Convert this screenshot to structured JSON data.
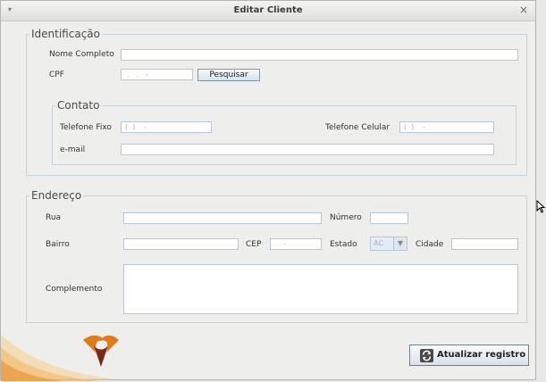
{
  "window": {
    "title": "Editar Cliente",
    "close_glyph": "×",
    "menu_glyph": "▾"
  },
  "identificacao": {
    "legend": "Identificação",
    "nome_label": "Nome Completo",
    "nome_value": "",
    "cpf_label": "CPF",
    "cpf_mask": " .   .   -",
    "search_button": "Pesquisar"
  },
  "contato": {
    "legend": "Contato",
    "telefone_fixo_label": "Telefone Fixo",
    "telefone_fixo_mask": "(  )    -",
    "telefone_celular_label": "Telefone Celular",
    "telefone_celular_mask": "(  )    -",
    "email_label": "e-mail",
    "email_value": ""
  },
  "endereco": {
    "legend": "Endereço",
    "rua_label": "Rua",
    "rua_value": "",
    "numero_label": "Número",
    "numero_value": "",
    "bairro_label": "Bairro",
    "bairro_value": "",
    "cep_label": "CEP",
    "cep_mask": "    -",
    "estado_label": "Estado",
    "estado_value": "AC",
    "cidade_label": "Cidade",
    "cidade_value": "",
    "complemento_label": "Complemento",
    "complemento_value": ""
  },
  "actions": {
    "update_button": "Atualizar registro",
    "update_icon": "refresh-icon"
  },
  "colors": {
    "group_border": "#c4d4e2",
    "field_border": "#b8c7d6",
    "logo_orange": "#e07b1a",
    "logo_dark": "#7a2a12"
  }
}
